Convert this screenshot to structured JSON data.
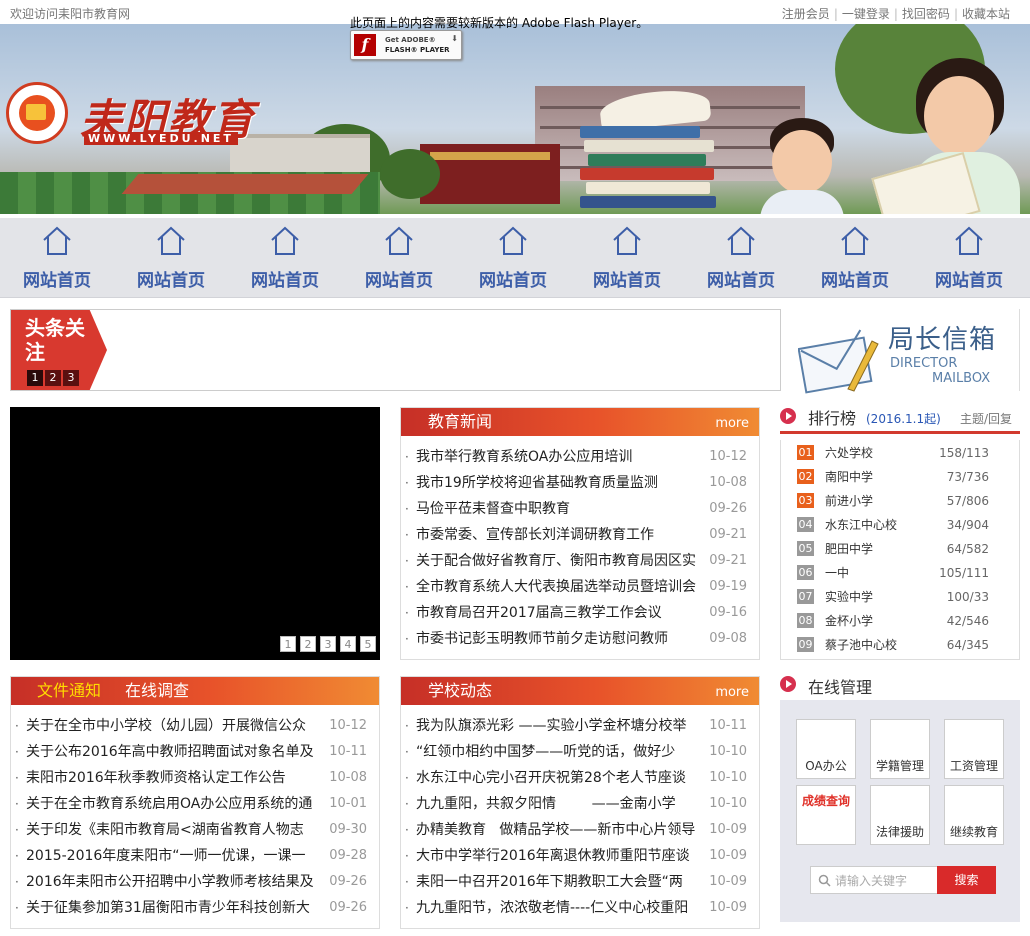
{
  "topbar": {
    "welcome": "欢迎访问耒阳市教育网",
    "links": [
      "注册会员",
      "一键登录",
      "找回密码",
      "收藏本站"
    ]
  },
  "flash": {
    "notice": "此页面上的内容需要较新版本的 Adobe Flash Player。",
    "btn_line1": "Get ADOBE®",
    "btn_line2": "FLASH® PLAYER"
  },
  "logo": {
    "title": "耒阳教育",
    "url": "WWW.LYEDU.NET"
  },
  "nav": {
    "items": [
      "网站首页",
      "网站首页",
      "网站首页",
      "网站首页",
      "网站首页",
      "网站首页",
      "网站首页",
      "网站首页",
      "网站首页"
    ]
  },
  "headline": {
    "badge": "头条关注",
    "pages": [
      "1",
      "2",
      "3"
    ]
  },
  "mailbox": {
    "title_cn": "局长信箱",
    "title_en1": "DIRECTOR",
    "title_en2": "MAILBOX"
  },
  "video": {
    "pages": [
      "1",
      "2",
      "3",
      "4",
      "5"
    ]
  },
  "news": {
    "title": "教育新闻",
    "more": "more",
    "items": [
      {
        "title": "我市举行教育系统OA办公应用培训",
        "date": "10-12"
      },
      {
        "title": "我市19所学校将迎省基础教育质量监测",
        "date": "10-08"
      },
      {
        "title": "马俭平莅耒督查中职教育",
        "date": "09-26"
      },
      {
        "title": "市委常委、宣传部长刘洋调研教育工作",
        "date": "09-21"
      },
      {
        "title": "关于配合做好省教育厅、衡阳市教育局因区实",
        "date": "09-21"
      },
      {
        "title": "全市教育系统人大代表换届选举动员暨培训会",
        "date": "09-19"
      },
      {
        "title": "市教育局召开2017届高三教学工作会议",
        "date": "09-16"
      },
      {
        "title": "市委书记彭玉明教师节前夕走访慰问教师",
        "date": "09-08"
      }
    ]
  },
  "notices": {
    "tab_active": "文件通知",
    "tab_inactive": "在线调查",
    "items": [
      {
        "title": "关于在全市中小学校（幼儿园）开展微信公众",
        "date": "10-12"
      },
      {
        "title": "关于公布2016年高中教师招聘面试对象名单及",
        "date": "10-11"
      },
      {
        "title": "耒阳市2016年秋季教师资格认定工作公告",
        "date": "10-08"
      },
      {
        "title": "关于在全市教育系统启用OA办公应用系统的通",
        "date": "10-01"
      },
      {
        "title": "关于印发《耒阳市教育局<湖南省教育人物志",
        "date": "09-30"
      },
      {
        "title": "2015-2016年度耒阳市“一师一优课，一课一",
        "date": "09-28"
      },
      {
        "title": "2016年耒阳市公开招聘中小学教师考核结果及",
        "date": "09-26"
      },
      {
        "title": "关于征集参加第31届衡阳市青少年科技创新大",
        "date": "09-26"
      }
    ]
  },
  "school": {
    "title": "学校动态",
    "more": "more",
    "items": [
      {
        "title": "我为队旗添光彩 ——实验小学金杯塘分校举",
        "date": "10-11"
      },
      {
        "title": "“红领巾相约中国梦——听党的话，做好少",
        "date": "10-10"
      },
      {
        "title": "水东江中心完小召开庆祝第28个老人节座谈",
        "date": "10-10"
      },
      {
        "title": "九九重阳，共叙夕阳情        ——金南小学",
        "date": "10-10"
      },
      {
        "title": "办精美教育   做精品学校——新市中心片领导",
        "date": "10-09"
      },
      {
        "title": "大市中学举行2016年离退休教师重阳节座谈",
        "date": "10-09"
      },
      {
        "title": "耒阳一中召开2016年下期教职工大会暨“两",
        "date": "10-09"
      },
      {
        "title": "九九重阳节，浓浓敬老情----仁义中心校重阳",
        "date": "10-09"
      }
    ]
  },
  "rank": {
    "title": "排行榜",
    "since": "(2016.1.1起)",
    "header": "主题/回复",
    "items": [
      {
        "no": "01",
        "name": "六处学校",
        "value": "158/113"
      },
      {
        "no": "02",
        "name": "南阳中学",
        "value": "73/736"
      },
      {
        "no": "03",
        "name": "前进小学",
        "value": "57/806"
      },
      {
        "no": "04",
        "name": "水东江中心校",
        "value": "34/904"
      },
      {
        "no": "05",
        "name": "肥田中学",
        "value": "64/582"
      },
      {
        "no": "06",
        "name": "一中",
        "value": "105/111"
      },
      {
        "no": "07",
        "name": "实验中学",
        "value": "100/33"
      },
      {
        "no": "08",
        "name": "金杯小学",
        "value": "42/546"
      },
      {
        "no": "09",
        "name": "蔡子池中心校",
        "value": "64/345"
      }
    ]
  },
  "manage": {
    "title": "在线管理",
    "buttons": [
      "OA办公",
      "学籍管理",
      "工资管理",
      "成绩查询",
      "法律援助",
      "继续教育"
    ],
    "search_placeholder": "请输入关键字",
    "search_button": "搜索"
  },
  "colors": {
    "accent_red": "#d8392f",
    "nav_text": "#3d5ea8",
    "rank_top": "#e8601c"
  }
}
